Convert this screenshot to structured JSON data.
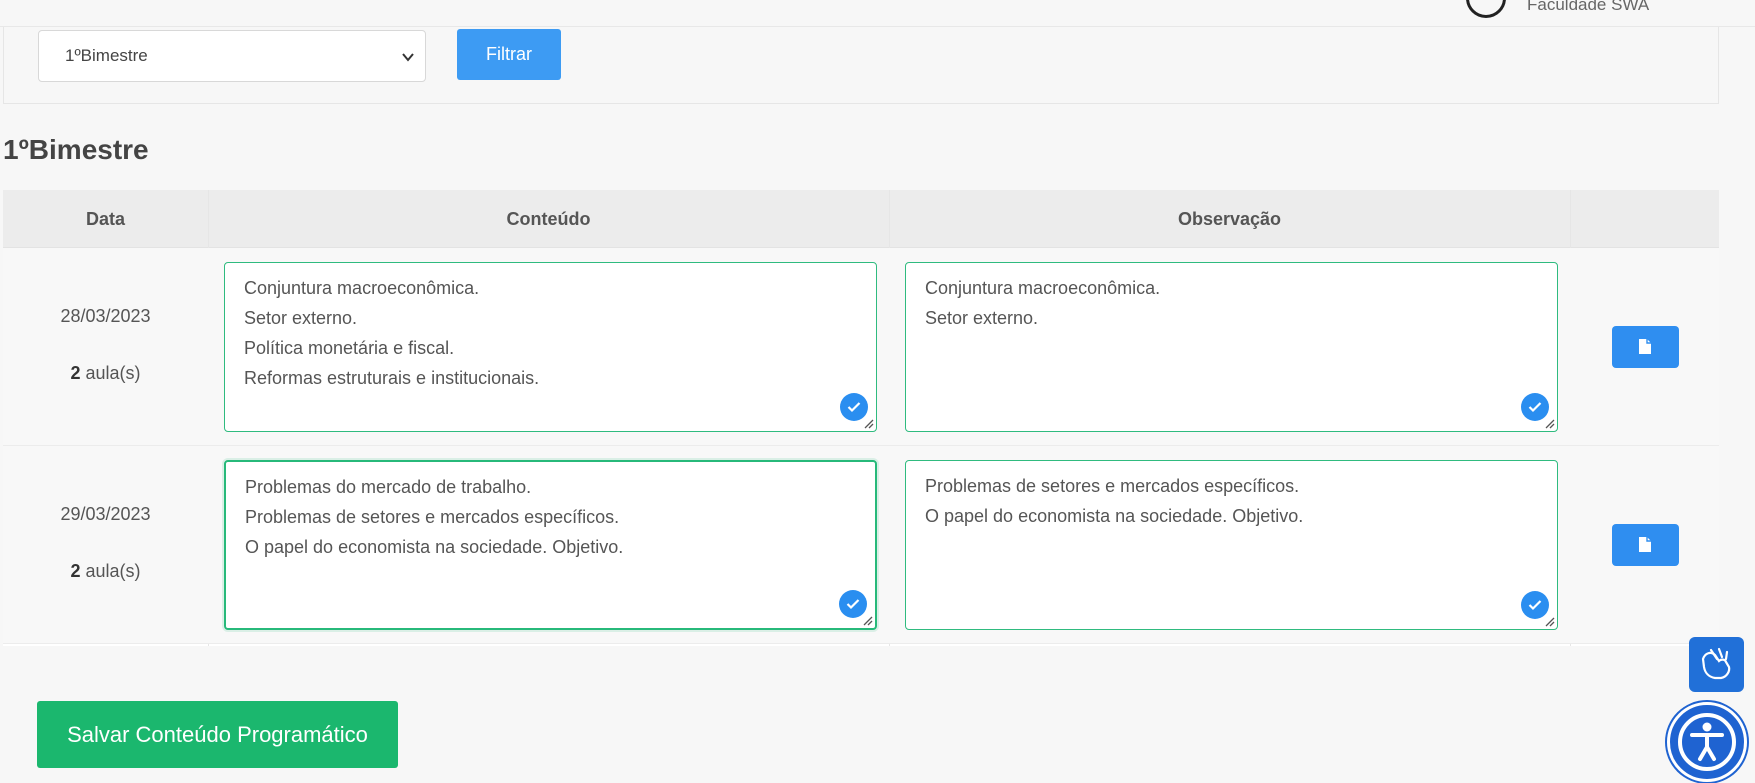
{
  "header": {
    "institution": "Faculdade SWA"
  },
  "filter": {
    "selected_period": "1ºBimestre",
    "filter_label": "Filtrar"
  },
  "section": {
    "title": "1ºBimestre"
  },
  "table": {
    "headers": [
      "Data",
      "Conteúdo",
      "Observação"
    ],
    "rows": [
      {
        "date": "28/03/2023",
        "lessons_count": "2",
        "lessons_suffix": "aula(s)",
        "content_lines": [
          "Conjuntura macroeconômica.",
          "Setor externo.",
          "Política monetária e fiscal.",
          "Reformas estruturais e institucionais."
        ],
        "observation_lines": [
          "Conjuntura macroeconômica.",
          "Setor externo."
        ]
      },
      {
        "date": "29/03/2023",
        "lessons_count": "2",
        "lessons_suffix": "aula(s)",
        "content_lines": [
          "Problemas do mercado de trabalho.",
          "Problemas de setores e mercados específicos.",
          "O papel do economista na sociedade. Objetivo."
        ],
        "observation_lines": [
          "Problemas de setores e mercados específicos.",
          "O papel do economista na sociedade. Objetivo."
        ]
      }
    ]
  },
  "actions": {
    "save_label": "Salvar Conteúdo Programático"
  },
  "colors": {
    "primary": "#3d9bf3",
    "success": "#1bb76e",
    "textbox_border": "#2fbb7f",
    "accessibility": "#1f63d1"
  },
  "icons": {
    "row_action": "document-icon",
    "field_status": "check-circle-icon",
    "libras": "hand-sign-icon",
    "accessibility": "accessibility-icon"
  }
}
